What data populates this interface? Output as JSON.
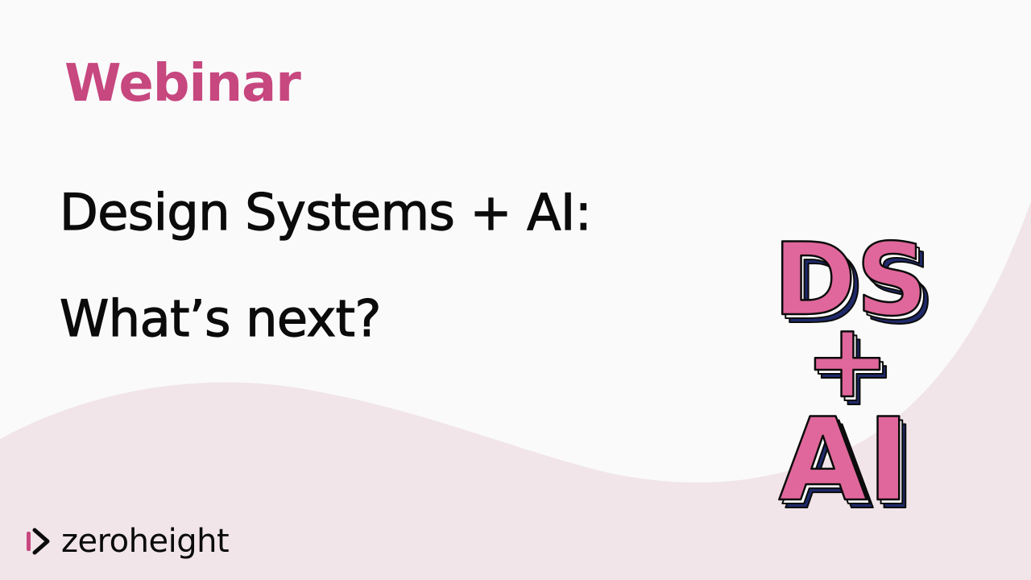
{
  "slide": {
    "eyebrow": "Webinar",
    "title_lines": [
      "Design Systems + AI:",
      "What’s next?"
    ]
  },
  "badge": {
    "line1": "DS",
    "line2": "+",
    "line3": "AI"
  },
  "brand": {
    "name": "zeroheight",
    "icon": "zeroheight-logo-icon"
  },
  "colors": {
    "accent_pink": "#c7477f",
    "badge_pink": "#e0679b",
    "badge_navy": "#1f2a6b",
    "text_dark": "#0b0b0b",
    "wave": "#f1e5ea",
    "background": "#fafafb"
  }
}
